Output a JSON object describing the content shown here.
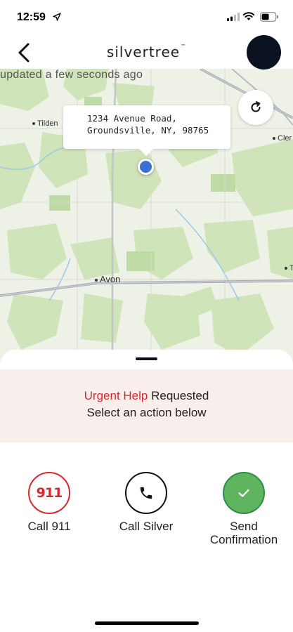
{
  "status_bar": {
    "time": "12:59",
    "icons": [
      "location-arrow-icon",
      "cellular-signal-icon",
      "wifi-icon",
      "battery-icon"
    ]
  },
  "header": {
    "back_icon": "chevron-left-icon",
    "brand": "silvertree",
    "brand_tm": "™"
  },
  "map": {
    "updated_text": "updated a few seconds ago",
    "address_line1": "1234 Avenue Road,",
    "address_line2": "Groundsville, NY, 98765",
    "places": {
      "tilden": "Tilden",
      "clerk": "Cler",
      "avon": "Avon",
      "edge_t": "T"
    },
    "refresh_icon": "refresh-icon",
    "pin_color": "#3b6fd1"
  },
  "alert": {
    "urgent": "Urgent Help",
    "requested": " Requested",
    "instruction": "Select an action below",
    "urgent_color": "#d8282b",
    "background": "#f8eeec"
  },
  "actions": {
    "call_911": {
      "icon_text": "911",
      "label": "Call 911"
    },
    "call_silver": {
      "icon": "phone-icon",
      "label": "Call Silver"
    },
    "send_confirmation": {
      "icon": "checkmark-icon",
      "label_line1": "Send",
      "label_line2": "Confirmation"
    }
  },
  "colors": {
    "red": "#d8282b",
    "green": "#5fb45f",
    "map_green": "#cde6b8"
  }
}
